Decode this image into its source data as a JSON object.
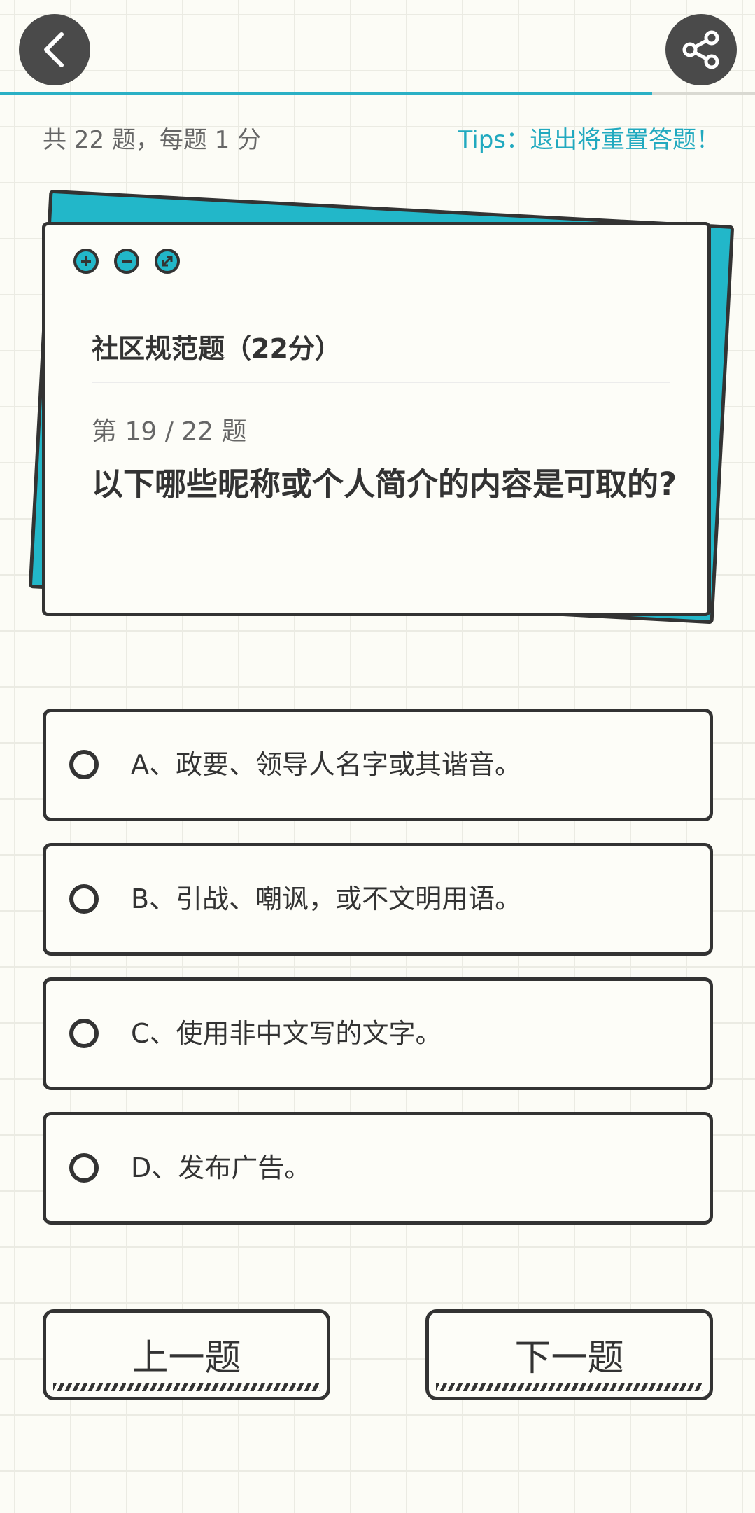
{
  "header": {
    "back_icon": "chevron-left-icon",
    "share_icon": "share-icon",
    "progress_fraction": 0.864
  },
  "meta": {
    "summary": "共 22 题，每题 1 分",
    "tip": "Tips：退出将重置答题！"
  },
  "card": {
    "window_icons": [
      "plus-circle-icon",
      "minus-circle-icon",
      "expand-circle-icon"
    ],
    "section_title": "社区规范题（22分）",
    "question_index": "第 19 / 22 题",
    "question_text": "以下哪些昵称或个人简介的内容是可取的?"
  },
  "options": [
    {
      "label": "A、政要、领导人名字或其谐音。",
      "selected": false
    },
    {
      "label": "B、引战、嘲讽，或不文明用语。",
      "selected": false
    },
    {
      "label": "C、使用非中文写的文字。",
      "selected": false
    },
    {
      "label": "D、发布广告。",
      "selected": false
    }
  ],
  "nav": {
    "prev_label": "上一题",
    "next_label": "下一题"
  },
  "colors": {
    "accent": "#22b7c9",
    "tip_text": "#21a9bf",
    "dark": "#333333",
    "background": "#fcfcf6"
  }
}
